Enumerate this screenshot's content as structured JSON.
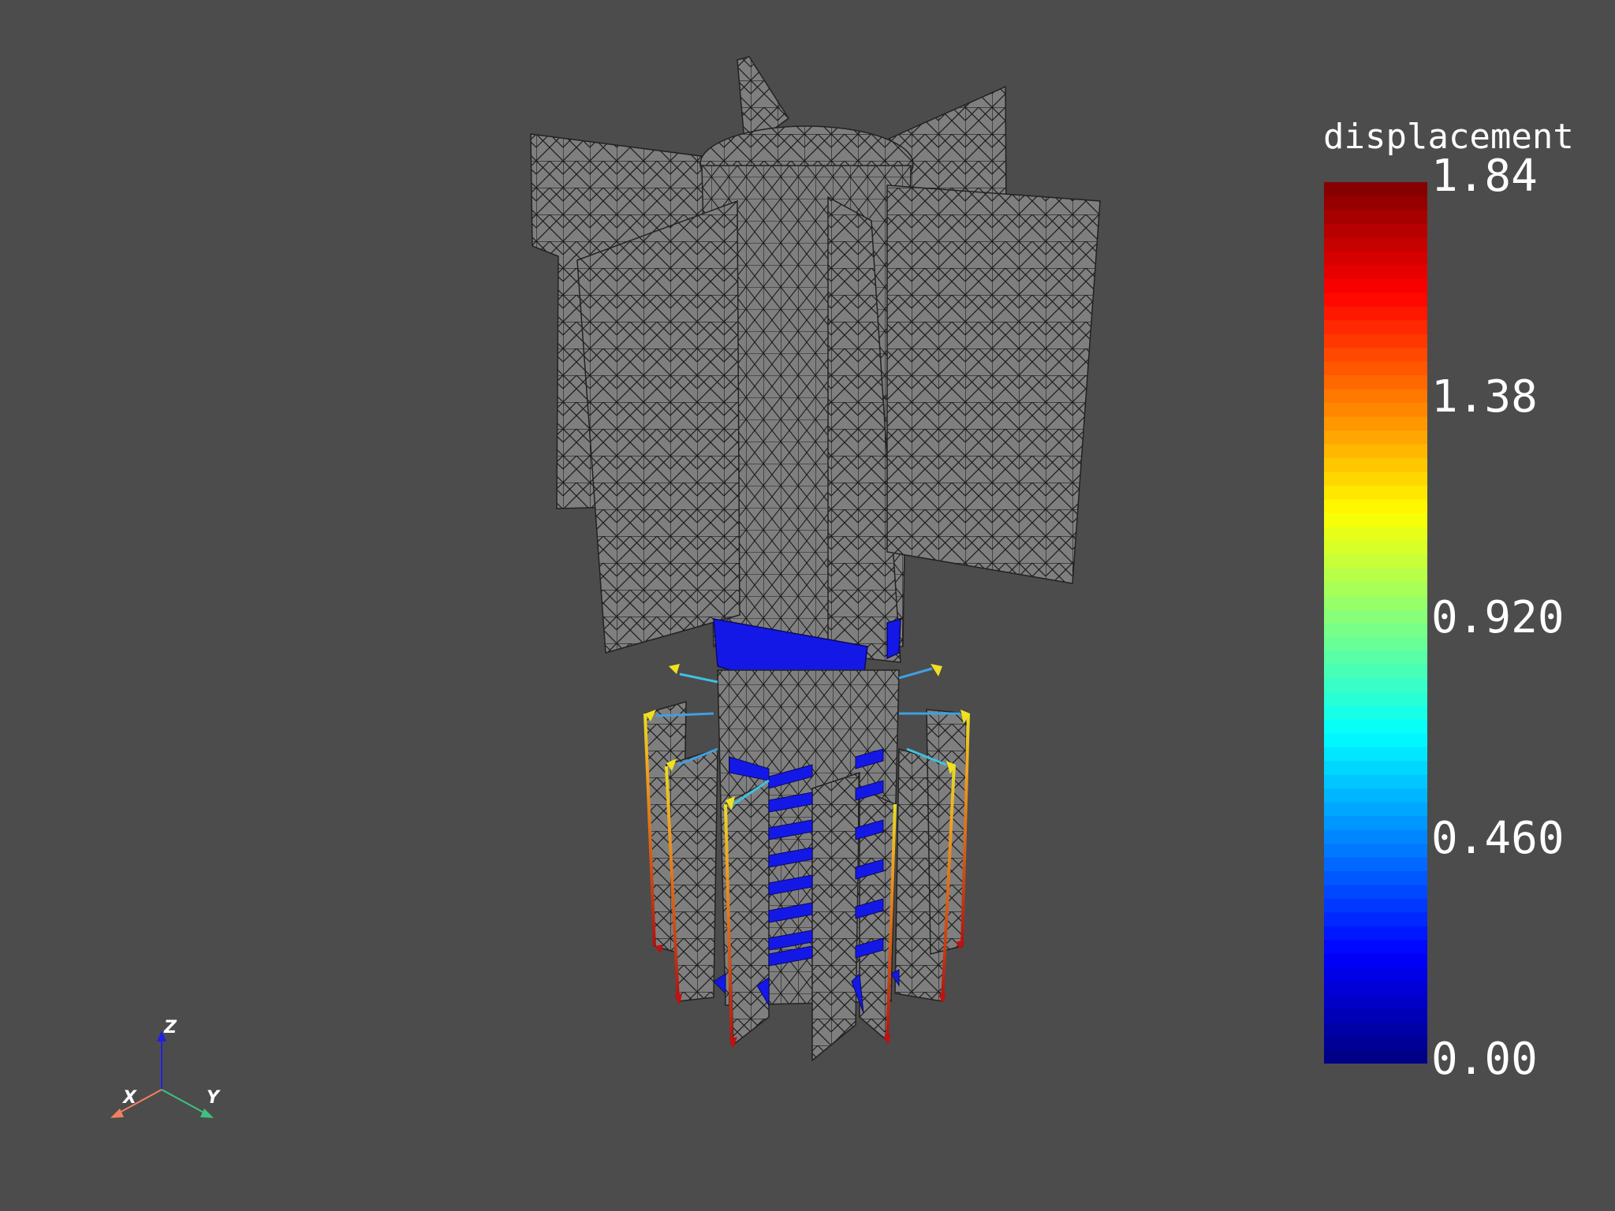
{
  "scene": {
    "background": "#4c4c4c",
    "mesh_color": "#7f7f7f",
    "edge_color": "#1a1a1a"
  },
  "colorbar": {
    "title": "displacement",
    "colormap": "jet",
    "min": 0.0,
    "max": 1.84,
    "ticks": [
      "1.84",
      "1.38",
      "0.920",
      "0.460",
      "0.00"
    ],
    "tick_values": [
      1.84,
      1.38,
      0.92,
      0.46,
      0.0
    ]
  },
  "axes_widget": {
    "x_label": "X",
    "y_label": "Y",
    "z_label": "Z",
    "x_color": "#f28060",
    "y_color": "#40c080",
    "z_color": "#2020e0"
  }
}
